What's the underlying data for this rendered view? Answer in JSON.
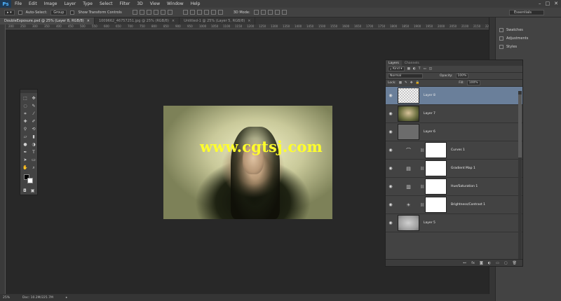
{
  "menu": [
    "File",
    "Edit",
    "Image",
    "Layer",
    "Type",
    "Select",
    "Filter",
    "3D",
    "View",
    "Window",
    "Help"
  ],
  "app_logo": "Ps",
  "options": {
    "auto_select_label": "Auto-Select:",
    "auto_select_value": "Group",
    "show_transform": "Show Transform Controls",
    "mode_label": "3D Mode:"
  },
  "workspace": "Essentials",
  "tabs": [
    "DoubleExposure.psd @ 25% (Layer 8, RGB/8)",
    "1009662_46757251.jpg @ 25% (RGB/8)",
    "Untitled-1 @ 25% (Layer 5, RGB/8)"
  ],
  "ruler_ticks": [
    "200",
    "250",
    "300",
    "350",
    "400",
    "450",
    "500",
    "550",
    "600",
    "650",
    "700",
    "750",
    "800",
    "850",
    "900",
    "950",
    "1000",
    "1050",
    "1100",
    "1150",
    "1200",
    "1250",
    "1300",
    "1350",
    "1400",
    "1450",
    "1500",
    "1550",
    "1600",
    "1650",
    "1700",
    "1750",
    "1800",
    "1850",
    "1900",
    "1950",
    "2000",
    "2050",
    "2100",
    "2150",
    "2200"
  ],
  "watermark": "www.cgtsj.com",
  "right_panel": [
    "Swatches",
    "Adjustments",
    "Styles"
  ],
  "layers_panel": {
    "tabs": [
      "Layers",
      "Channels"
    ],
    "kind": "Kind",
    "blend_mode": "Normal",
    "opacity_label": "Opacity:",
    "opacity": "100%",
    "lock_label": "Lock:",
    "fill_label": "Fill:",
    "fill": "100%",
    "layers": [
      {
        "name": "Layer 8",
        "thumb": "t-trans",
        "selected": true
      },
      {
        "name": "Layer 7",
        "thumb": "t-photo"
      },
      {
        "name": "Layer 6",
        "thumb": "t-gray"
      },
      {
        "name": "Curves 1",
        "adj": "curves-icon",
        "glyph": "⌒"
      },
      {
        "name": "Gradient Map 1",
        "adj": "gradient-map-icon",
        "glyph": "▤"
      },
      {
        "name": "Hue/Saturation 1",
        "adj": "hue-saturation-icon",
        "glyph": "▥"
      },
      {
        "name": "Brightness/Contrast 1",
        "adj": "brightness-contrast-icon",
        "glyph": "☀"
      },
      {
        "name": "Layer 5",
        "thumb": "t-tex"
      }
    ],
    "footer_icons": [
      "link-icon",
      "fx-icon",
      "mask-icon",
      "adjustment-icon",
      "group-icon",
      "new-layer-icon",
      "trash-icon"
    ],
    "footer_glyphs": [
      "⊷",
      "fx",
      "◙",
      "◐",
      "▭",
      "▢",
      "🗑"
    ]
  },
  "status": {
    "zoom": "25%",
    "doc": "Doc: 10.2M/225.7M"
  }
}
